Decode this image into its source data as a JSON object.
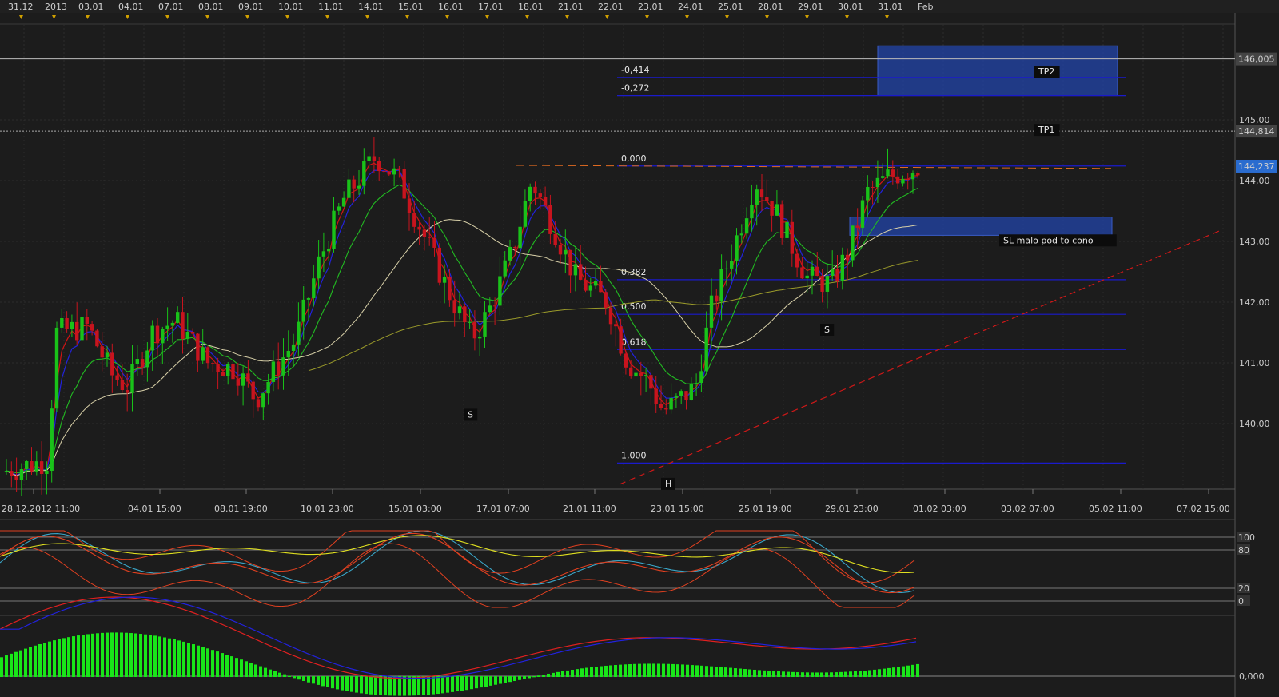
{
  "colors": {
    "background": "#1c1c1c",
    "grid": "#2d2d2d",
    "candle_up": "#19c219",
    "candle_down": "#c8141e",
    "ema_fast": "#d21414",
    "ema_mid": "#2222dd",
    "ema_green": "#22bb22",
    "ma_slow": "#d8d0a8",
    "ma_200": "#9a9a2a",
    "fib": "#1a1acc",
    "zone_fill": "#2244aa",
    "trend_line": "#d01818",
    "price_label_bg": "#2a6ccf",
    "macd_hist": "#19e619",
    "stoch_k": "#3aa6c8",
    "stoch_d": "#e0e020"
  },
  "top_dates": [
    "31.12",
    "2013",
    "03.01",
    "04.01",
    "07.01",
    "08.01",
    "09.01",
    "10.01",
    "11.01",
    "14.01",
    "15.01",
    "16.01",
    "17.01",
    "18.01",
    "21.01",
    "22.01",
    "23.01",
    "24.01",
    "25.01",
    "28.01",
    "29.01",
    "30.01",
    "31.01",
    "Feb"
  ],
  "bottom_dates": [
    "28.12.2012 11:00",
    "04.01 15:00",
    "08.01 19:00",
    "10.01 23:00",
    "15.01 03:00",
    "17.01 07:00",
    "21.01 11:00",
    "23.01 15:00",
    "25.01 19:00",
    "29.01 23:00",
    "01.02 03:00",
    "03.02 07:00",
    "05.02 11:00",
    "07.02 15:00"
  ],
  "price_axis": {
    "ticks": [
      "145,00",
      "144,00",
      "143,00",
      "142,00",
      "141,00",
      "140,00"
    ],
    "current_price": "144,237",
    "tp1_price": "144,814",
    "tp2_price": "146,005"
  },
  "fib_levels": [
    {
      "label": "-0,414",
      "value": 145.7
    },
    {
      "label": "-0,272",
      "value": 145.4
    },
    {
      "label": "0,000",
      "value": 144.24
    },
    {
      "label": "0,382",
      "value": 142.37
    },
    {
      "label": "0,500",
      "value": 141.8
    },
    {
      "label": "0,618",
      "value": 141.22
    },
    {
      "label": "1,000",
      "value": 139.35
    }
  ],
  "annotations": {
    "tp2": "TP2",
    "tp1": "TP1",
    "sl": "SL malo pod to cono",
    "shoulder_left": "S",
    "shoulder_right": "S",
    "head": "H"
  },
  "stoch_axis": [
    "100",
    "80",
    "20",
    "0"
  ],
  "macd_axis": "0,000",
  "chart_data": {
    "type": "line",
    "title": "",
    "xlabel": "",
    "ylabel": "",
    "ylim": [
      139.0,
      146.6
    ],
    "x": [
      "28.12.2012 11:00",
      "04.01 15:00",
      "08.01 19:00",
      "10.01 23:00",
      "15.01 03:00",
      "17.01 07:00",
      "21.01 11:00",
      "23.01 15:00",
      "25.01 19:00",
      "29.01 23:00",
      "01.02 03:00"
    ],
    "series": [
      {
        "values": [
          139.3,
          141.6,
          141.3,
          142.4,
          144.4,
          142.0,
          142.9,
          140.2,
          143.8,
          142.5,
          144.24
        ]
      }
    ]
  }
}
